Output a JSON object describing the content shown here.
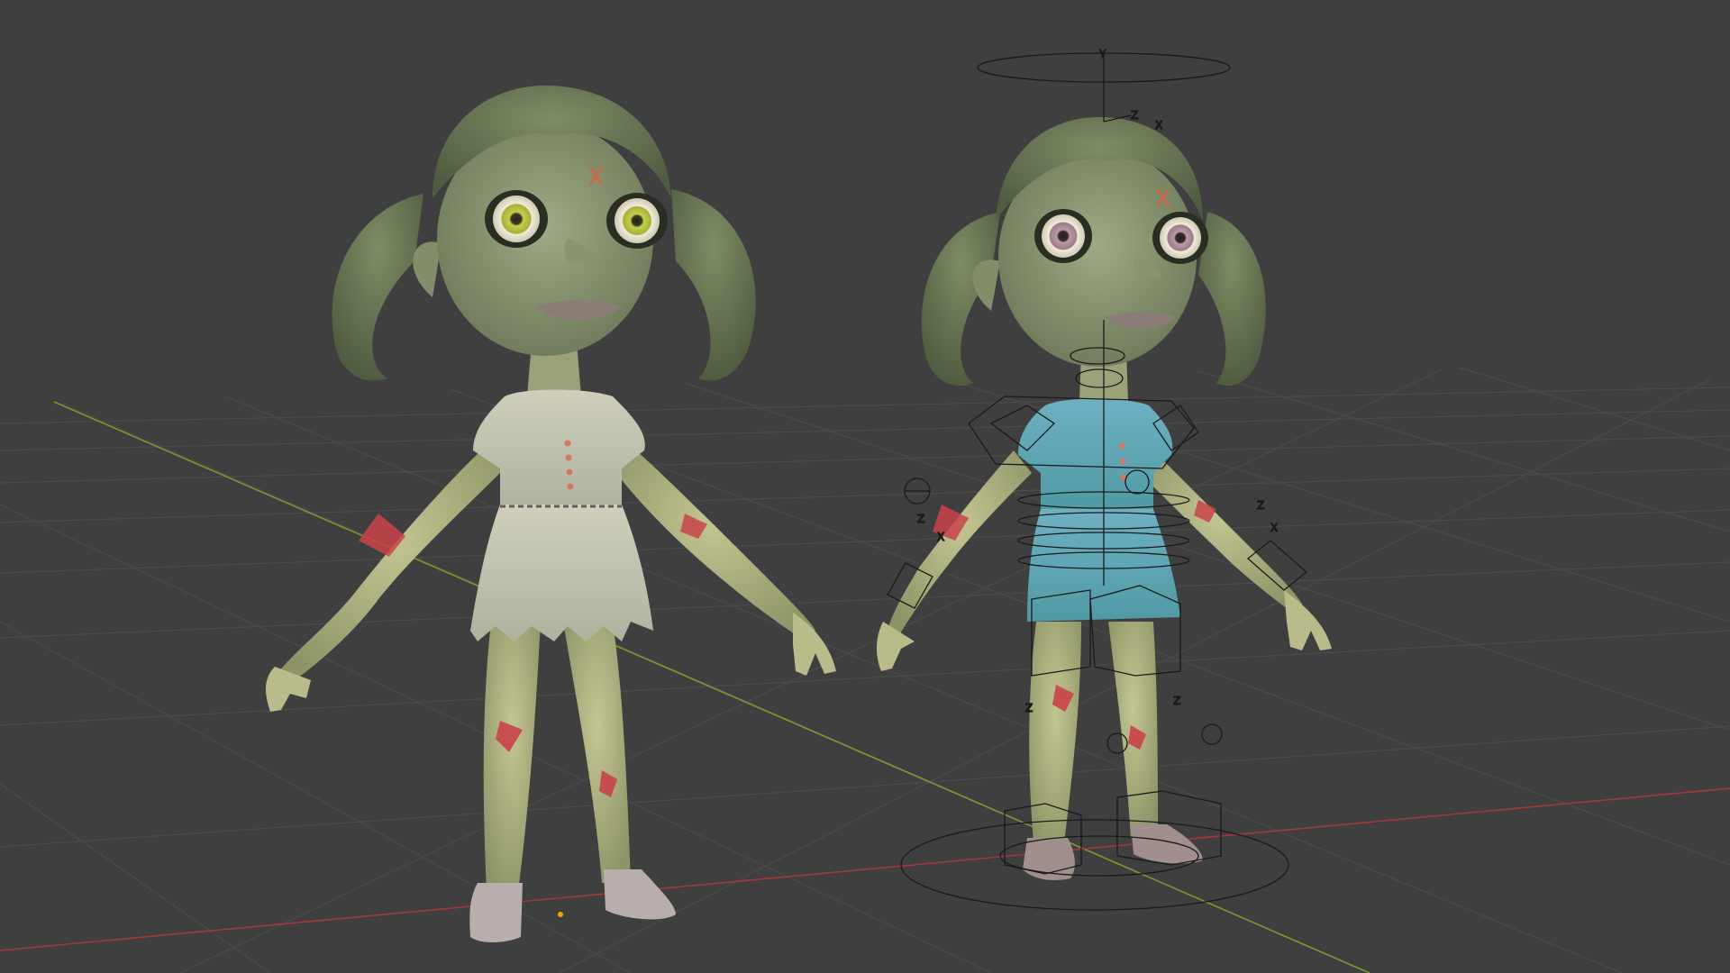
{
  "app": {
    "name": "3D viewport",
    "background_color": "#3f3f3f",
    "grid_color": "#4a4a4a",
    "x_axis_color": "#a3363f",
    "y_axis_color": "#7a9a2a"
  },
  "scene": {
    "objects": [
      {
        "name": "zombie-girl-mesh",
        "rigged": false
      },
      {
        "name": "zombie-girl-rigged",
        "rigged": true
      }
    ],
    "origin_marker_color": "#f2a300",
    "skin_color": "#b5ba82",
    "hair_color": "#6b7a56",
    "dress_left_color": "#c6c7b3",
    "dress_right_color": "#66a6b3",
    "wound_color": "#c9434a"
  },
  "rig_labels": {
    "root_y": "Y",
    "root_z": "Z",
    "root_x": "X",
    "axis_z": "Z",
    "axis_x": "X"
  }
}
